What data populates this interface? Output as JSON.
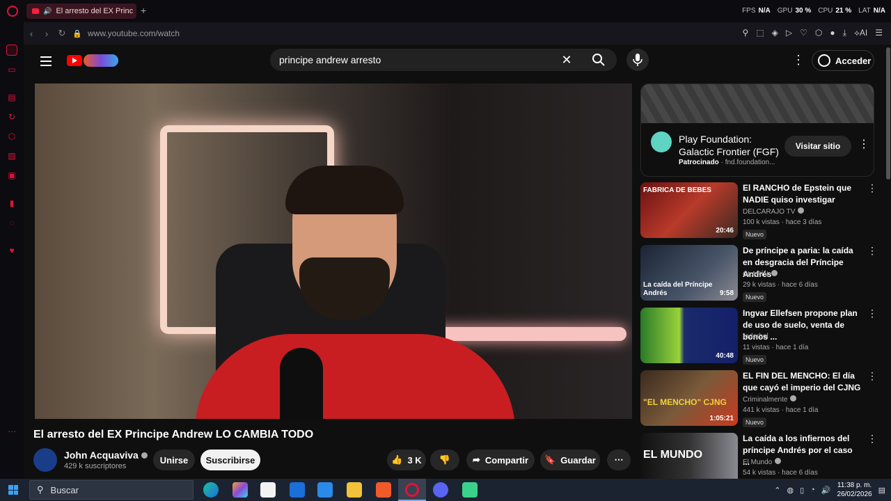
{
  "browser": {
    "tab_title": "El arresto del EX Princ",
    "new_tab": "+",
    "url": "www.youtube.com/watch",
    "stats": [
      {
        "label": "FPS",
        "value": "N/A"
      },
      {
        "label": "GPU",
        "value": "30 %"
      },
      {
        "label": "CPU",
        "value": "21 %"
      },
      {
        "label": "LAT",
        "value": "N/A"
      }
    ],
    "ai_label": "AI"
  },
  "youtube": {
    "search_query": "principe andrew  arresto",
    "signin_label": "Acceder",
    "video": {
      "title": "El arresto del EX Principe Andrew LO CAMBIA TODO",
      "channel": "John Acquaviva",
      "subscribers": "429 k suscriptores",
      "join_label": "Unirse",
      "subscribe_label": "Suscribirse",
      "likes": "3 K",
      "share_label": "Compartir",
      "save_label": "Guardar"
    },
    "ad": {
      "title": "Play Foundation: Galactic Frontier (FGF)",
      "sponsored": "Patrocinado",
      "domain": "fnd.foundation...",
      "visit_label": "Visitar sitio"
    },
    "recommendations": [
      {
        "title": "El RANCHO de Epstein que NADIE quiso investigar",
        "channel": "DELCARAJO TV",
        "stats": "100 k vistas · hace 3 días",
        "badge": "Nuevo",
        "duration": "20:46",
        "thumb_text": "FABRICA DE BEBES"
      },
      {
        "title": "De príncipe a paria: la caída en desgracia del Príncipe Andrés",
        "channel": "CLARÍN",
        "stats": "29 k vistas · hace 6 días",
        "badge": "Nuevo",
        "duration": "9:58",
        "thumb_text": "La caída del Príncipe Andrés"
      },
      {
        "title": "Ingvar Ellefsen propone plan de uso de suelo, venta de bonos ...",
        "channel": "rederbol",
        "stats": "11 vistas · hace 1 día",
        "badge": "Nuevo",
        "duration": "40:48",
        "thumb_text": ""
      },
      {
        "title": "EL FIN DEL MENCHO: El día que cayó el imperio del CJNG",
        "channel": "Criminalmente",
        "stats": "441 k vistas · hace 1 día",
        "badge": "Nuevo",
        "duration": "1:05:21",
        "thumb_text": "\"EL MENCHO\" CJNG"
      },
      {
        "title": "La caída a los infiernos del príncipe Andrés por el caso ...",
        "channel": "El Mundo",
        "stats": "54 k vistas · hace 6 días",
        "badge": "",
        "duration": "",
        "thumb_text": "EL MUNDO"
      }
    ]
  },
  "taskbar": {
    "search_placeholder": "Buscar",
    "time": "11:38 p. m.",
    "date": "26/02/2026"
  }
}
